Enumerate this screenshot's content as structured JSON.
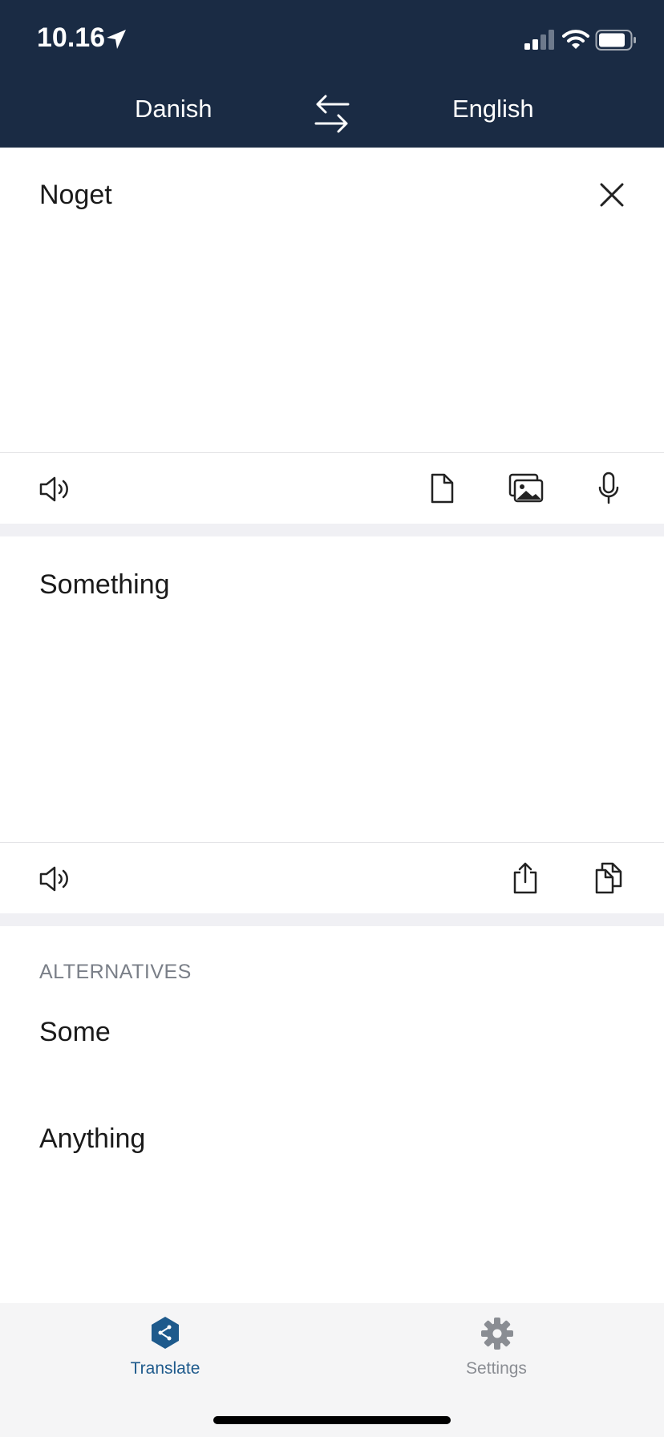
{
  "status_bar": {
    "time": "10.16"
  },
  "header": {
    "source_language": "Danish",
    "target_language": "English"
  },
  "source": {
    "text": "Noget"
  },
  "target": {
    "text": "Something"
  },
  "alternatives": {
    "heading": "ALTERNATIVES",
    "items": [
      "Some",
      "Anything"
    ]
  },
  "tabbar": {
    "translate_label": "Translate",
    "settings_label": "Settings",
    "active": "Translate"
  },
  "colors": {
    "header_bg": "#1a2b44",
    "accent": "#1e5a8c",
    "inactive": "#8a8d93"
  }
}
